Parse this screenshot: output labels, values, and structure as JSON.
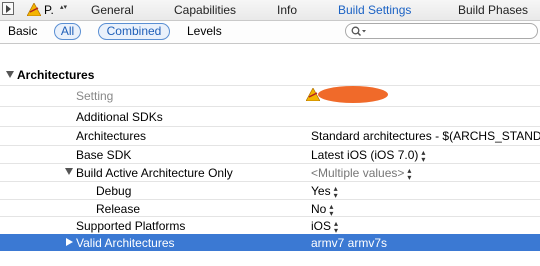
{
  "target": {
    "name": "P.",
    "stepper": "▴▾"
  },
  "tabs": [
    {
      "label": "General"
    },
    {
      "label": "Capabilities"
    },
    {
      "label": "Info"
    },
    {
      "label": "Build Settings"
    },
    {
      "label": "Build Phases"
    }
  ],
  "filters": {
    "basic": "Basic",
    "all": "All",
    "combined": "Combined",
    "levels": "Levels",
    "search_placeholder": ""
  },
  "section": {
    "title": "Architectures",
    "setting_header": "Setting"
  },
  "rows": [
    {
      "label": "Additional SDKs",
      "value": ""
    },
    {
      "label": "Architectures",
      "value": "Standard architectures  -  $(ARCHS_STAND"
    },
    {
      "label": "Base SDK",
      "value": "Latest iOS (iOS 7.0)"
    },
    {
      "label": "Build Active Architecture Only",
      "value": "<Multiple values>"
    },
    {
      "label": "Debug",
      "value": "Yes"
    },
    {
      "label": "Release",
      "value": "No"
    },
    {
      "label": "Supported Platforms",
      "value": "iOS"
    },
    {
      "label": "Valid Architectures",
      "value": "armv7 armv7s"
    }
  ],
  "colors": {
    "accent": "#1b62c4",
    "selection": "#3b79d3",
    "redaction": "#f06a2a"
  },
  "icons": [
    "panel-toggle-icon",
    "target-icon",
    "search-icon",
    "disclosure-triangle-icon",
    "redaction-blob"
  ]
}
